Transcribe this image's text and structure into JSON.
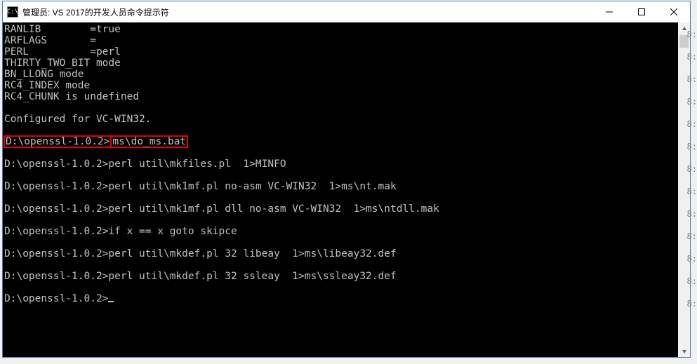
{
  "window": {
    "title": "管理员: VS 2017的开发人员命令提示符",
    "icon_text": "C:\\"
  },
  "highlight": {
    "prompt": "D:\\openssl-1.0.2>",
    "cmd": "ms\\do_ms.bat"
  },
  "final_prompt": "D:\\openssl-1.0.2>",
  "lines": [
    "RANLIB        =true",
    "ARFLAGS       =",
    "PERL          =perl",
    "THIRTY_TWO_BIT mode",
    "BN_LLONG mode",
    "RC4_INDEX mode",
    "RC4_CHUNK is undefined",
    "",
    "Configured for VC-WIN32.",
    "",
    "__HL__",
    "",
    "D:\\openssl-1.0.2>perl util\\mkfiles.pl  1>MINFO",
    "",
    "D:\\openssl-1.0.2>perl util\\mk1mf.pl no-asm VC-WIN32  1>ms\\nt.mak",
    "",
    "D:\\openssl-1.0.2>perl util\\mk1mf.pl dll no-asm VC-WIN32  1>ms\\ntdll.mak",
    "",
    "D:\\openssl-1.0.2>if x == x goto skipce",
    "",
    "D:\\openssl-1.0.2>perl util\\mkdef.pl 32 libeay  1>ms\\libeay32.def",
    "",
    "D:\\openssl-1.0.2>perl util\\mkdef.pl 32 ssleay  1>ms\\ssleay32.def",
    "",
    "__PROMPT__"
  ],
  "edge_numbers": [
    "8:",
    "",
    "8:",
    "8:",
    "8:",
    "",
    "8:",
    "8:",
    "8:",
    "8:",
    "8:",
    "8:",
    "8:",
    "8:",
    "8:"
  ]
}
